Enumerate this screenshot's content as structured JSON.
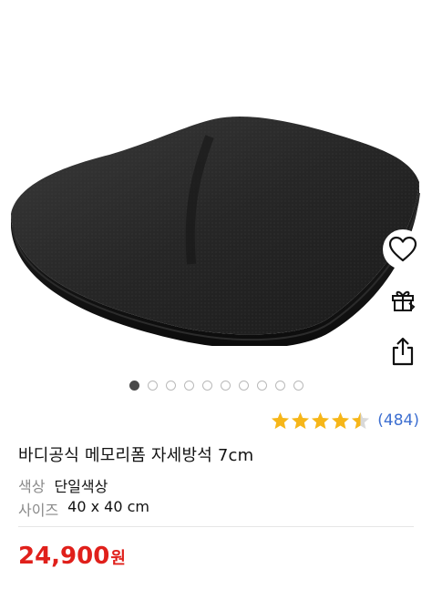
{
  "gallery": {
    "image_count": 10,
    "active_index": 0
  },
  "actions": {
    "wishlist_icon": "heart-icon",
    "gift_icon": "gift-icon",
    "share_icon": "share-icon"
  },
  "rating": {
    "stars": 4.5,
    "review_count": "(484)",
    "star_color": "#f6b619"
  },
  "product": {
    "title": "바디공식 메모리폼 자세방석 7cm",
    "options": [
      {
        "label": "색상",
        "value": "단일색상"
      },
      {
        "label": "사이즈",
        "value": "40 x 40 cm"
      }
    ],
    "price": "24,900",
    "price_unit": "원",
    "price_color": "#e0201b"
  }
}
